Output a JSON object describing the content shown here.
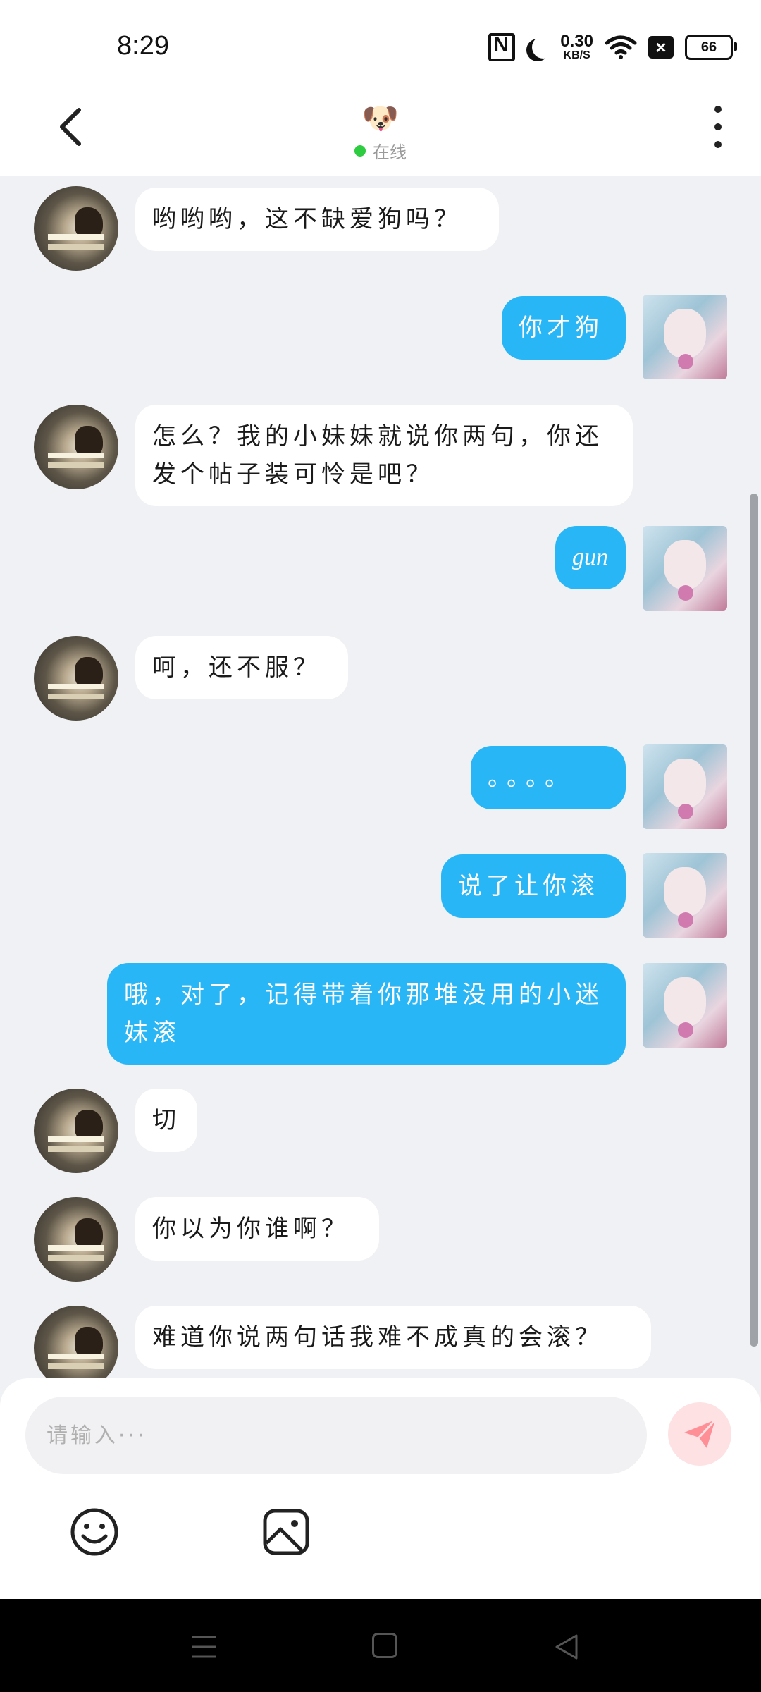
{
  "status_bar": {
    "time": "8:29",
    "net_speed_value": "0.30",
    "net_speed_unit": "KB/S",
    "battery": "66",
    "icons": [
      "nfc-icon",
      "moon-icon",
      "wifi-icon",
      "notification-x-icon",
      "battery-icon"
    ]
  },
  "header": {
    "avatar_emoji": "🐶",
    "status_text": "在线",
    "status_color": "#2ecc40"
  },
  "messages": [
    {
      "side": "left",
      "text": "哟哟哟，这不缺爱狗吗？"
    },
    {
      "side": "right",
      "text": "你才狗"
    },
    {
      "side": "left",
      "text": "怎么？我的小妹妹就说你两句，你还发个帖子装可怜是吧？"
    },
    {
      "side": "right",
      "text": "gun"
    },
    {
      "side": "left",
      "text": "呵，还不服？"
    },
    {
      "side": "right",
      "text": "。。。。"
    },
    {
      "side": "right",
      "text": "说了让你滚"
    },
    {
      "side": "right",
      "text": "哦，对了，记得带着你那堆没用的小迷妹滚"
    },
    {
      "side": "left",
      "text": "切"
    },
    {
      "side": "left",
      "text": "你以为你谁啊？"
    },
    {
      "side": "left",
      "text": "难道你说两句话我难不成真的会滚？"
    }
  ],
  "input": {
    "placeholder": "请输入···",
    "value": ""
  },
  "colors": {
    "sent_bubble": "#29b6f6",
    "received_bubble": "#ffffff",
    "chat_background": "#f0f1f4",
    "send_button": "#fde1e3",
    "send_icon": "#ff8f96"
  },
  "bottom_tools": [
    "emoji-icon",
    "image-icon"
  ],
  "nav_bar": [
    "menu-icon",
    "home-icon",
    "back-icon"
  ]
}
